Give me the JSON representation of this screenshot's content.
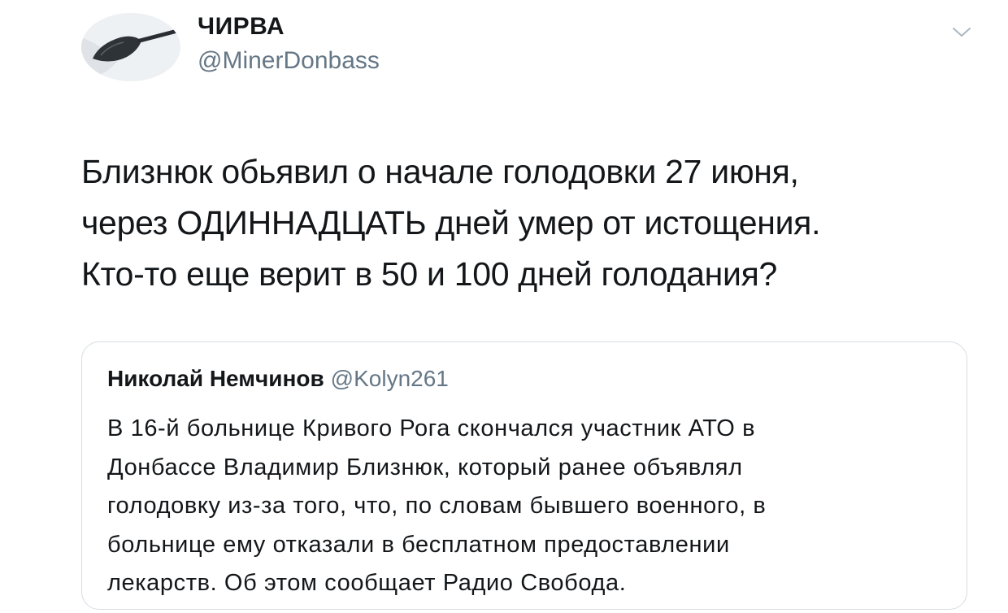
{
  "tweet": {
    "author": {
      "display_name": "ЧИРВА",
      "handle": "@MinerDonbass",
      "avatar_icon": "shovel-avatar-icon"
    },
    "menu_icon": "chevron-down-icon",
    "text": "Близнюк обьявил о начале голодовки 27 июня,\nчерез ОДИННАДЦАТЬ дней умер от истощения.\nКто-то еще верит в 50 и 100 дней голодания?"
  },
  "quoted_tweet": {
    "author_name": "Николай Немчинов",
    "author_handle": "@Kolyn261",
    "text": "В 16-й больнице Кривого Рога скончался участник АТО  в\nДонбассе Владимир Близнюк, который ранее объявлял\nголодовку из-за того, что, по словам бывшего военного, в\nбольнице ему отказали в бесплатном предоставлении\nлекарств. Об этом сообщает Радио Свобода."
  },
  "colors": {
    "primary_text": "#14171a",
    "secondary_text": "#657786",
    "card_border": "#d6dde3"
  }
}
